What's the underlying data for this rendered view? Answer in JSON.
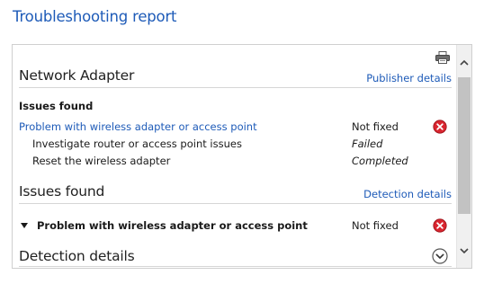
{
  "page": {
    "title": "Troubleshooting report"
  },
  "report": {
    "print_icon": "printer-icon",
    "network_adapter": {
      "title": "Network Adapter",
      "link": "Publisher details",
      "issues_label": "Issues found",
      "problem": {
        "label": "Problem with wireless adapter or access point",
        "status": "Not fixed",
        "status_icon": "error-x-icon",
        "status_color": "#d9252f"
      },
      "steps": [
        {
          "label": "Investigate router or access point issues",
          "status": "Failed"
        },
        {
          "label": "Reset the wireless adapter",
          "status": "Completed"
        }
      ]
    },
    "issues_found": {
      "title": "Issues found",
      "link": "Detection details",
      "problem": {
        "label": "Problem with wireless adapter or access point",
        "status": "Not fixed",
        "expand_icon": "triangle-down-icon",
        "status_icon": "error-x-icon"
      }
    },
    "detection_details": {
      "title": "Detection details",
      "toggle_icon": "chevron-down-circle-icon"
    }
  },
  "scrollbar": {
    "up_icon": "chevron-up-icon",
    "down_icon": "chevron-down-icon"
  }
}
